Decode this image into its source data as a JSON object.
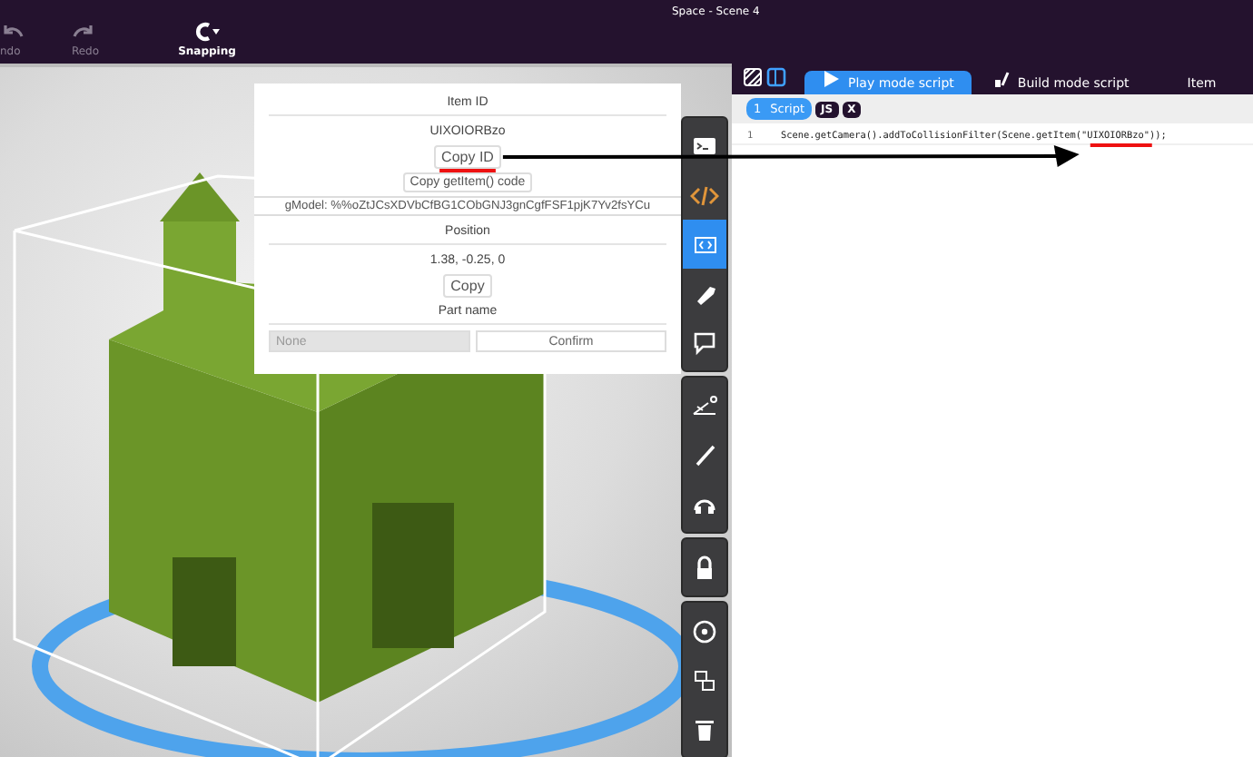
{
  "window": {
    "title": "Space - Scene 4"
  },
  "toolbar": [
    {
      "kind": "undo",
      "label": "ndo",
      "disabled": true
    },
    {
      "kind": "redo",
      "label": "Redo",
      "disabled": true
    },
    {
      "kind": "snapping",
      "label": "Snapping",
      "disabled": false
    }
  ],
  "item_panel": {
    "id_heading": "Item ID",
    "item_id": "UIXOIORBzo",
    "copy_id_button": "Copy ID",
    "copy_code_button": "Copy getItem() code",
    "model_field": "gModel: %%oZtJCsXDVbCfBG1CObGNJ3gnCgfFSF1pjK7Yv2fsYCu",
    "position_heading": "Position",
    "position": "1.38, -0.25, 0",
    "copy_button": "Copy",
    "part_name_heading": "Part name",
    "part_name_placeholder": "None",
    "confirm_button": "Confirm"
  },
  "side_tools": [
    [
      {
        "kind": "terminal",
        "selected": false
      },
      {
        "kind": "code",
        "selected": false
      },
      {
        "kind": "script-window",
        "selected": true
      },
      {
        "kind": "tag",
        "selected": false
      },
      {
        "kind": "speech",
        "selected": false
      }
    ],
    [
      {
        "kind": "angle",
        "selected": false
      },
      {
        "kind": "brush",
        "selected": false
      },
      {
        "kind": "headphones",
        "selected": false
      }
    ],
    [
      {
        "kind": "lock",
        "selected": false
      }
    ],
    [
      {
        "kind": "disc",
        "selected": false
      },
      {
        "kind": "swap",
        "selected": false
      },
      {
        "kind": "trash",
        "selected": false
      }
    ]
  ],
  "editor": {
    "tabs": [
      {
        "kind": "play",
        "label": "Play mode script",
        "selected": true
      },
      {
        "kind": "build",
        "label": "Build mode script",
        "selected": false
      },
      {
        "kind": "plain",
        "label": "Item",
        "selected": false
      }
    ],
    "script_tab": {
      "number": "1",
      "label": "Script",
      "badges": [
        "JS",
        "X"
      ]
    },
    "lines": [
      {
        "number": "1",
        "code": "Scene.getCamera().addToCollisionFilter(Scene.getItem(\"UIXOIORBzo\"));"
      }
    ]
  }
}
